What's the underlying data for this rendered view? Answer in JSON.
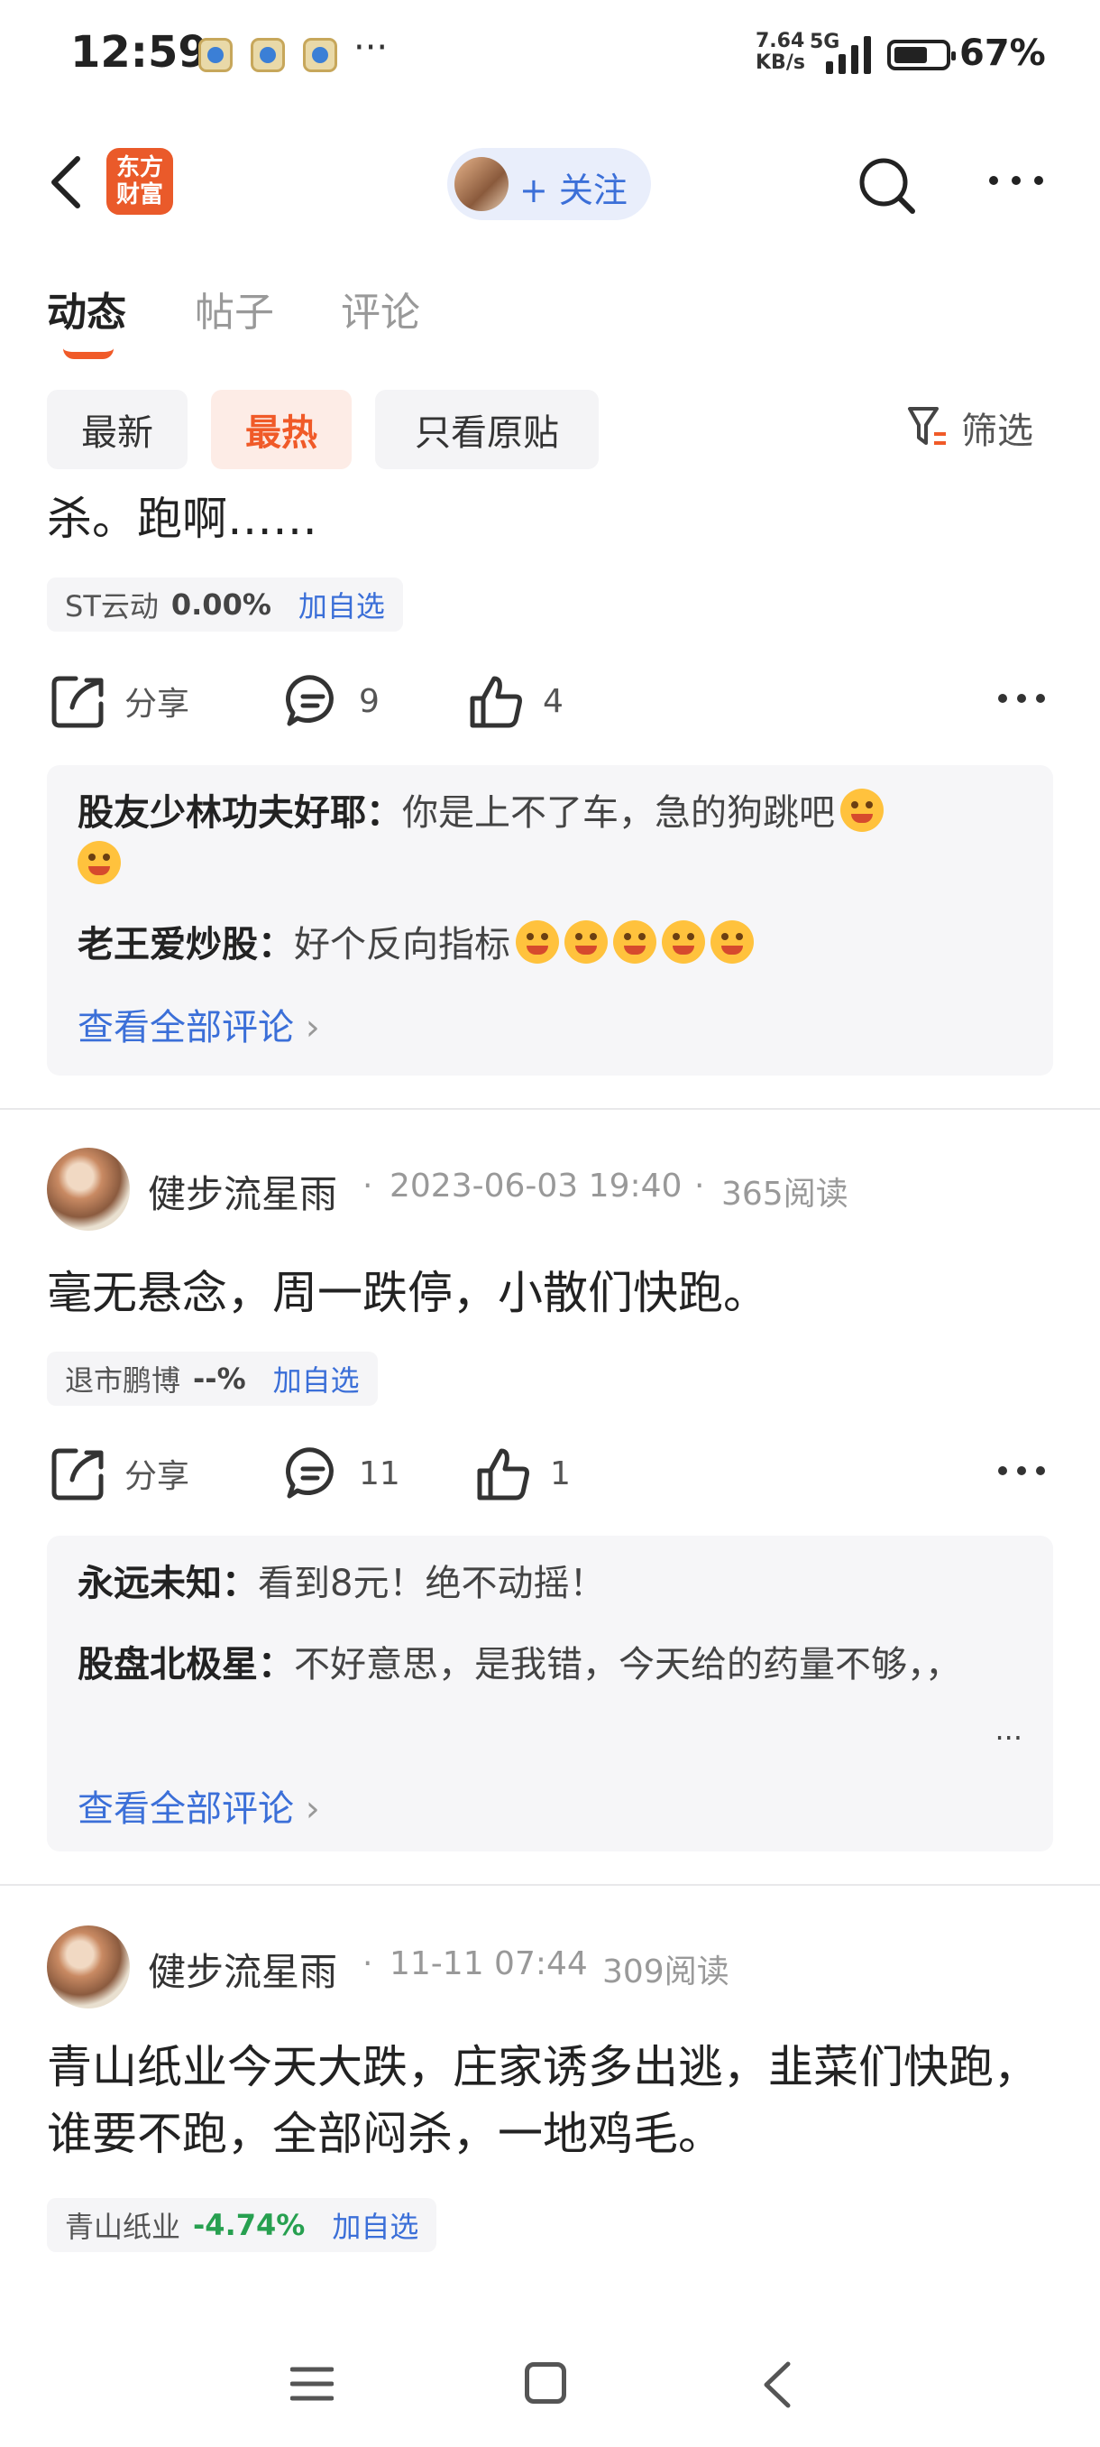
{
  "status_bar": {
    "time": "12:59",
    "more": "···",
    "speed_top": "7.64",
    "speed_bottom": "KB/s",
    "network": "5G",
    "battery_level": 0.67,
    "battery": "67%"
  },
  "header": {
    "logo_text": "东方财富",
    "follow_label": "+ 关注"
  },
  "tabs": [
    {
      "label": "动态",
      "active": true
    },
    {
      "label": "帖子",
      "active": false
    },
    {
      "label": "评论",
      "active": false
    }
  ],
  "chips": [
    {
      "label": "最新",
      "active": false
    },
    {
      "label": "最热",
      "active": true
    },
    {
      "label": "只看原贴",
      "active": false
    }
  ],
  "filter_label": "筛选",
  "posts": [
    {
      "text": "杀。跑啊……",
      "stock": {
        "name": "ST云动",
        "change": "0.00%",
        "add": "加自选"
      },
      "share_label": "分享",
      "comments_count": "9",
      "likes_count": "4",
      "comments": [
        {
          "user": "股友少林功夫好耶：",
          "text": "你是上不了车，急的狗跳吧"
        },
        {
          "user": "老王爱炒股：",
          "text": "好个反向指标"
        }
      ],
      "see_all": "查看全部评论"
    },
    {
      "author": "健步流星雨",
      "date": "2023-06-03 19:40",
      "reads": "365阅读",
      "text": "毫无悬念，周一跌停，小散们快跑。",
      "stock": {
        "name": "退市鹏博",
        "change": "--%",
        "add": "加自选"
      },
      "share_label": "分享",
      "comments_count": "11",
      "likes_count": "1",
      "comments": [
        {
          "user": "永远未知：",
          "text": "看到8元！绝不动摇！"
        },
        {
          "user": "股盘北极星：",
          "text": "不好意思，是我错，今天给的药量不够，，"
        }
      ],
      "ellipsis": "...",
      "see_all": "查看全部评论"
    },
    {
      "author": "健步流星雨",
      "date": "11-11 07:44",
      "reads": "309阅读",
      "text": "青山纸业今天大跌，庄家诱多出逃，韭菜们快跑，谁要不跑，全部闷杀，一地鸡毛。",
      "stock": {
        "name": "青山纸业",
        "change": "-4.74%",
        "add": "加自选"
      }
    }
  ],
  "meta_sep": "·"
}
